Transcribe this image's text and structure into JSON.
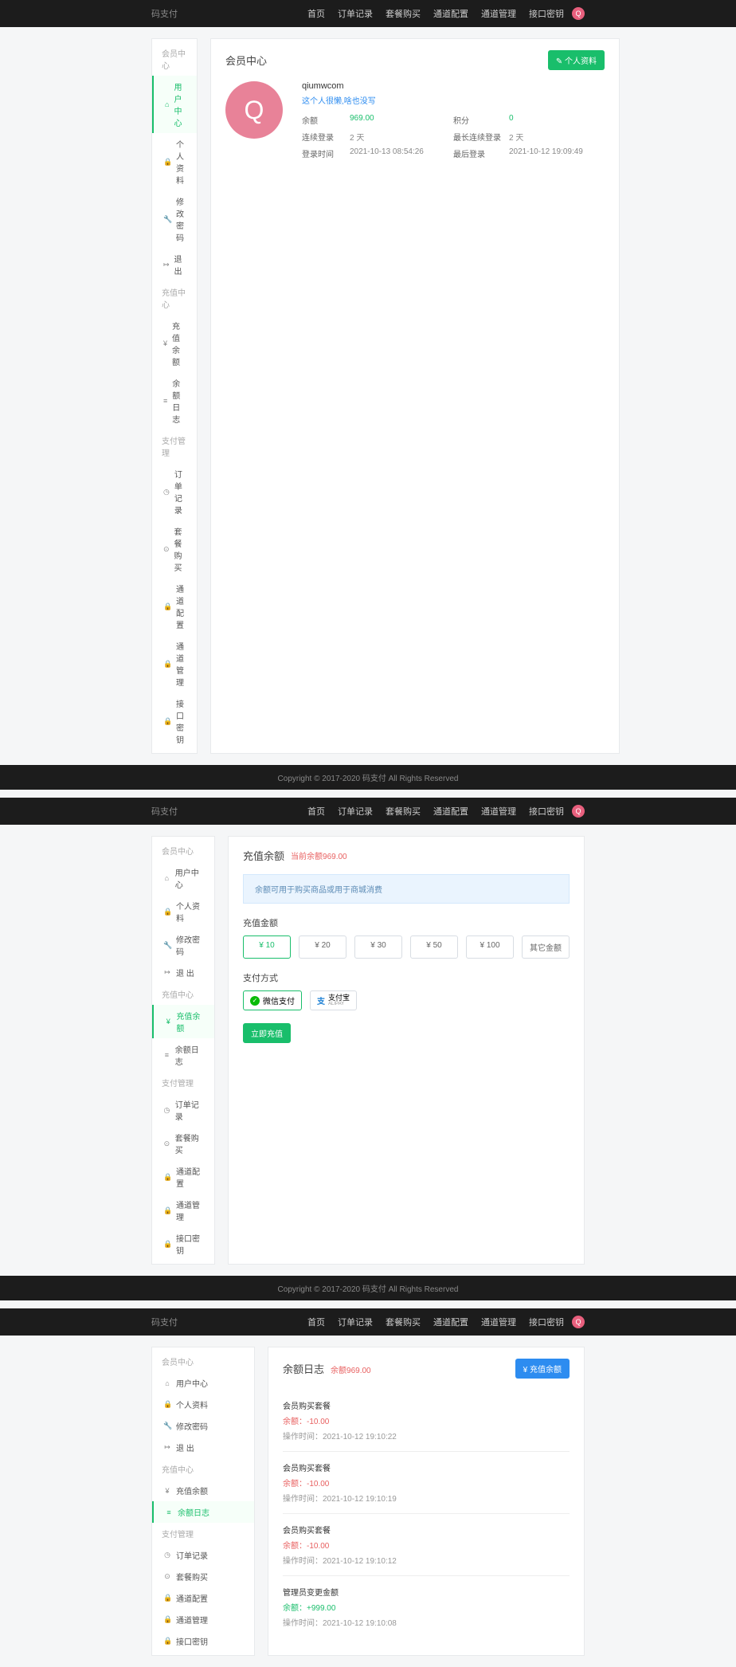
{
  "common": {
    "brand": "码支付",
    "nav": [
      "首页",
      "订单记录",
      "套餐购买",
      "通道配置",
      "通道管理",
      "接口密钥"
    ],
    "avatar_letter": "Q",
    "footer": "Copyright © 2017-2020 码支付 All Rights Reserved",
    "sidebar": {
      "g1_title": "会员中心",
      "g1": [
        "用户中心",
        "个人资料",
        "修改密码",
        "退 出"
      ],
      "g1_icons": [
        "⌂",
        "🔒",
        "🔧",
        "↦"
      ],
      "g2_title": "充值中心",
      "g2": [
        "充值余额",
        "余额日志"
      ],
      "g2_icons": [
        "¥",
        "≡"
      ],
      "g3_title": "支付管理",
      "g3": [
        "订单记录",
        "套餐购买",
        "通道配置",
        "通道管理",
        "接口密钥"
      ],
      "g3_icons": [
        "◷",
        "⊙",
        "🔒",
        "🔒",
        "🔒"
      ]
    }
  },
  "s1": {
    "title": "会员中心",
    "btn": "✎ 个人资料",
    "username": "qiumwcom",
    "signature": "这个人很懒,啥也没写",
    "rows": [
      [
        "余额",
        "969.00",
        "积分",
        "0"
      ],
      [
        "连续登录",
        "2 天",
        "最长连续登录",
        "2 天"
      ],
      [
        "登录时间",
        "2021-10-13 08:54:26",
        "最后登录",
        "2021-10-12 19:09:49"
      ]
    ]
  },
  "s2": {
    "title": "充值余额",
    "note": "当前余额969.00",
    "alert": "余额可用于购买商品或用于商城消费",
    "amount_label": "充值金额",
    "amounts": [
      "¥ 10",
      "¥ 20",
      "¥ 30",
      "¥ 50",
      "¥ 100",
      "其它金额"
    ],
    "pay_label": "支付方式",
    "wechat": "微信支付",
    "alipay": "支付宝",
    "ali_sub": "ALIPAY",
    "submit": "立即充值"
  },
  "s3": {
    "title": "余额日志",
    "note": "余额969.00",
    "btn": "¥ 充值余额",
    "logs": [
      {
        "t": "会员购买套餐",
        "a": "余额：-10.00",
        "neg": true,
        "time": "操作时间：2021-10-12 19:10:22"
      },
      {
        "t": "会员购买套餐",
        "a": "余额：-10.00",
        "neg": true,
        "time": "操作时间：2021-10-12 19:10:19"
      },
      {
        "t": "会员购买套餐",
        "a": "余额：-10.00",
        "neg": true,
        "time": "操作时间：2021-10-12 19:10:12"
      },
      {
        "t": "管理员变更金额",
        "a": "余额：+999.00",
        "neg": false,
        "time": "操作时间：2021-10-12 19:10:08"
      }
    ]
  }
}
